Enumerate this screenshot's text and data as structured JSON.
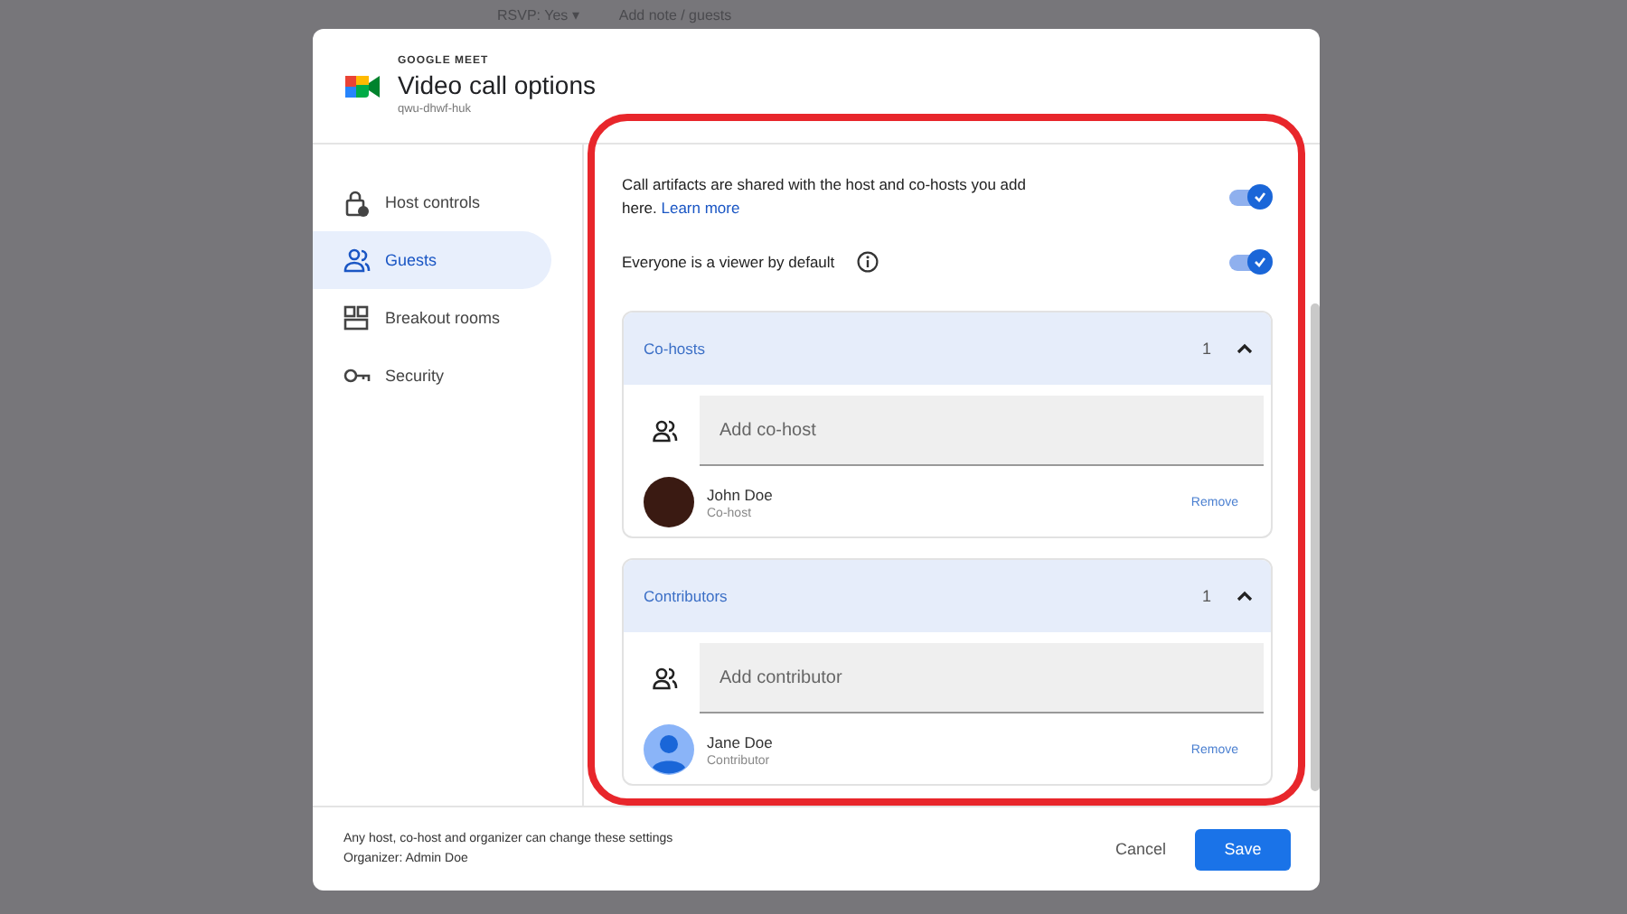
{
  "background": {
    "rsvp": "RSVP: Yes ▾",
    "note": "Add note / guests"
  },
  "dialog": {
    "app": "GOOGLE MEET",
    "title": "Video call options",
    "code": "qwu-dhwf-huk"
  },
  "sidebar": {
    "items": [
      {
        "kind": "lock",
        "label": "Host controls",
        "selected": false
      },
      {
        "kind": "people",
        "label": "Guests",
        "selected": true
      },
      {
        "kind": "rooms",
        "label": "Breakout rooms",
        "selected": false
      },
      {
        "kind": "key",
        "label": "Security",
        "selected": false
      }
    ]
  },
  "settings": [
    {
      "text": "Call artifacts are shared with the host and co-hosts you add here.",
      "link": "Learn more",
      "info": false,
      "on": true
    },
    {
      "text": "Everyone is a viewer by default",
      "info": true,
      "on": true
    }
  ],
  "sections": [
    {
      "title": "Co-hosts",
      "count": "1",
      "expanded": true,
      "placeholder": "Add co-host",
      "people": [
        {
          "name": "John Doe",
          "role": "Co-host",
          "kind": "photo",
          "action": "Remove"
        }
      ]
    },
    {
      "title": "Contributors",
      "count": "1",
      "expanded": true,
      "placeholder": "Add contributor",
      "people": [
        {
          "name": "Jane Doe",
          "role": "Contributor",
          "kind": "generic",
          "action": "Remove"
        }
      ]
    }
  ],
  "footer": {
    "note": "Any host, co-host and organizer can change these settings",
    "organizer": "Organizer: Admin Doe",
    "buttons": [
      {
        "kind": "text",
        "label": "Cancel"
      },
      {
        "kind": "primary",
        "label": "Save"
      }
    ]
  },
  "annotation_outline": true
}
